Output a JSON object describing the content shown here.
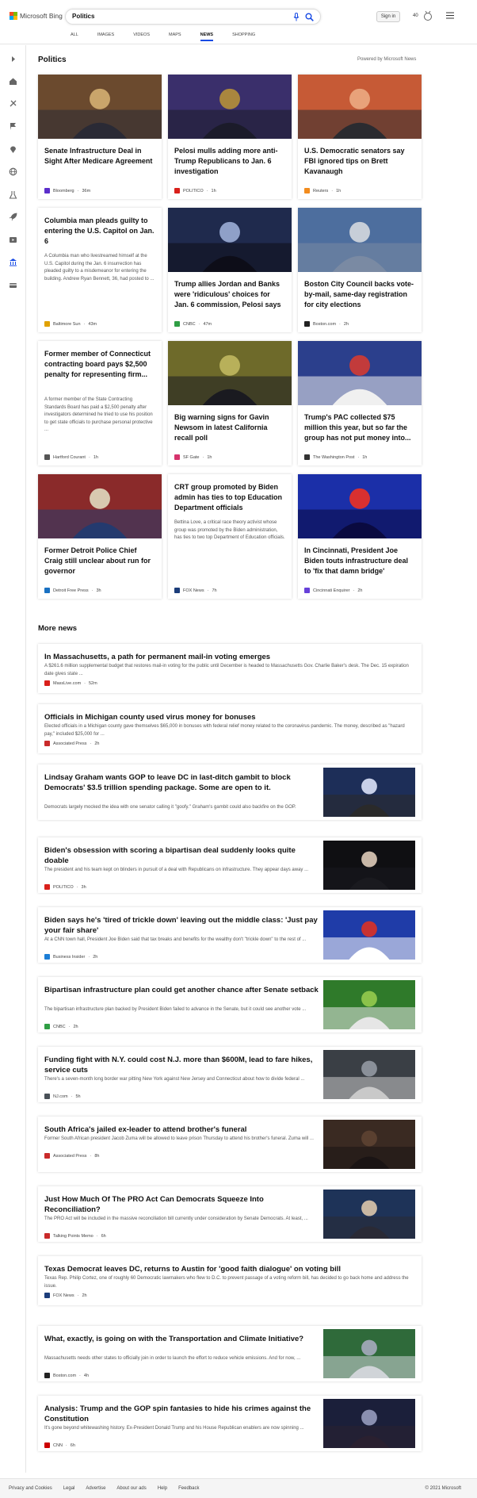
{
  "header": {
    "brand": "Microsoft Bing",
    "search_value": "Politics",
    "signin_label": "Sign in",
    "points": "40",
    "tabs": [
      "ALL",
      "IMAGES",
      "VIDEOS",
      "MAPS",
      "NEWS",
      "SHOPPING"
    ],
    "active_tab": "NEWS"
  },
  "rail": {
    "icons": [
      "expand-icon",
      "home-icon",
      "sports-icon",
      "flag-icon",
      "location-icon",
      "globe-icon",
      "science-icon",
      "rocket-icon",
      "entertainment-icon",
      "politics-icon",
      "money-icon"
    ]
  },
  "section": {
    "title": "Politics",
    "powered_by": "Powered by Microsoft News"
  },
  "cards": [
    {
      "title": "Senate Infrastructure Deal in Sight After Medicare Agreement",
      "snippet": "",
      "source": "Bloomberg",
      "time": "36m",
      "logo_color": "#5b2ecb",
      "image": "senate-photo"
    },
    {
      "title": "Pelosi mulls adding more anti-Trump Republicans to Jan. 6 investigation",
      "snippet": "",
      "source": "POLITICO",
      "time": "1h",
      "logo_color": "#d9201b",
      "image": "pelosi-photo"
    },
    {
      "title": "U.S. Democratic senators say FBI ignored tips on Brett Kavanaugh",
      "snippet": "",
      "source": "Reuters",
      "time": "1h",
      "logo_color": "#f28c1e",
      "image": "kavanaugh-photo"
    },
    {
      "title": "Columbia man pleads guilty to entering the U.S. Capitol on Jan. 6",
      "snippet": "A Columbia man who livestreamed himself at the U.S. Capitol during the Jan. 6 insurrection has pleaded guilty to a misdemeanor for entering the building. Andrew Ryan Bennett, 36, had posted to ...",
      "source": "Baltimore Sun",
      "time": "43m",
      "logo_color": "#e0a100",
      "image": ""
    },
    {
      "title": "Trump allies Jordan and Banks were 'ridiculous' choices for Jan. 6 commission, Pelosi says",
      "snippet": "",
      "source": "CNBC",
      "time": "47m",
      "logo_color": "#2f9e44",
      "image": "pelosi-speaking-photo"
    },
    {
      "title": "Boston City Council backs vote-by-mail, same-day registration for city elections",
      "snippet": "",
      "source": "Boston.com",
      "time": "2h",
      "logo_color": "#222222",
      "image": "vote-by-mail-photo"
    },
    {
      "title": "Former member of Connecticut contracting board pays $2,500 penalty for representing firm...",
      "snippet": "A former member of the State Contracting Standards Board has paid a $2,500 penalty after investigators determined he tried to use his position to get state officials to purchase personal protective ...",
      "source": "Hartford Courant",
      "time": "1h",
      "logo_color": "#555555",
      "image": ""
    },
    {
      "title": "Big warning signs for Gavin Newsom in latest California recall poll",
      "snippet": "",
      "source": "SF Gate",
      "time": "1h",
      "logo_color": "#d6336c",
      "image": "newsom-photo"
    },
    {
      "title": "Trump's PAC collected $75 million this year, but so far the group has not put money into...",
      "snippet": "",
      "source": "The Washington Post",
      "time": "1h",
      "logo_color": "#333333",
      "image": "trump-photo"
    },
    {
      "title": "Former Detroit Police Chief Craig still unclear about run for governor",
      "snippet": "",
      "source": "Detroit Free Press",
      "time": "3h",
      "logo_color": "#1971c2",
      "image": "craig-photo"
    },
    {
      "title": "CRT group promoted by Biden admin has ties to top Education Department officials",
      "snippet": "Bettina Love, a critical race theory activist whose group was promoted by the Biden administration, has ties to two top Department of Education officials.",
      "source": "FOX News",
      "time": "7h",
      "logo_color": "#1c3d7a",
      "image": ""
    },
    {
      "title": "In Cincinnati, President Joe Biden touts infrastructure deal to 'fix that damn bridge'",
      "snippet": "",
      "source": "Cincinnati Enquirer",
      "time": "2h",
      "logo_color": "#6741d9",
      "image": "cincinnati-photo"
    }
  ],
  "more_news": {
    "title": "More news",
    "items": [
      {
        "title": "In Massachusetts, a path for permanent mail-in voting emerges",
        "snippet": "A $261.6 million supplemental budget that restores mail-in voting for the public until December is headed to Massachusetts Gov. Charlie Baker's desk. The Dec. 15 expiration date gives state ...",
        "source": "MassLive.com",
        "time": "52m",
        "logo_color": "#d9201b",
        "image": ""
      },
      {
        "title": "Officials in Michigan county used virus money for bonuses",
        "snippet": "Elected officials in a Michigan county gave themselves $65,000 in bonuses with federal relief money related to the coronavirus pandemic. The money, described as \"hazard pay,\" included $25,000 for ...",
        "source": "Associated Press",
        "time": "2h",
        "logo_color": "#c92a2a",
        "image": ""
      },
      {
        "title": "Lindsay Graham wants GOP to leave DC in last-ditch gambit to block Democrats' $3.5 trillion spending package. Some are open to it.",
        "snippet": "Democrats largely mocked the idea with one senator calling it \"goofy.\" Graham's gambit could also backfire on the GOP.",
        "source": "Business Insider",
        "time": "1h",
        "logo_color": "#1c7ed6",
        "image": "senators-photo"
      },
      {
        "title": "Biden's obsession with scoring a bipartisan deal suddenly looks quite doable",
        "snippet": "The president and his team kept on blinders in pursuit of a deal with Republicans on infrastructure. They appear days away ...",
        "source": "POLITICO",
        "time": "3h",
        "logo_color": "#d9201b",
        "image": "biden-dark-photo"
      },
      {
        "title": "Biden says he's 'tired of trickle down' leaving out the middle class: 'Just pay your fair share'",
        "snippet": "At a CNN town hall, President Joe Biden said that tax breaks and benefits for the wealthy don't \"trickle down\" to the rest of ...",
        "source": "Business Insider",
        "time": "2h",
        "logo_color": "#1c7ed6",
        "image": "biden-townhall-photo"
      },
      {
        "title": "Bipartisan infrastructure plan could get another chance after Senate setback",
        "snippet": "The bipartisan infrastructure plan backed by President Biden failed to advance in the Senate, but it could see another vote ...",
        "source": "CNBC",
        "time": "2h",
        "logo_color": "#2f9e44",
        "image": "biden-tree-photo"
      },
      {
        "title": "Funding fight with N.Y. could cost N.J. more than $600M, lead to fare hikes, service cuts",
        "snippet": "There's a seven-month long border war pitting New York against New Jersey and Connecticut about how to divide federal ...",
        "source": "NJ.com",
        "time": "5h",
        "logo_color": "#495057",
        "image": "subway-photo"
      },
      {
        "title": "South Africa's jailed ex-leader to attend brother's funeral",
        "snippet": "Former South African president Jacob Zuma will be allowed to leave prison Thursday to attend his brother's funeral. Zuma will ...",
        "source": "Associated Press",
        "time": "8h",
        "logo_color": "#c92a2a",
        "image": "zuma-photo"
      },
      {
        "title": "Just How Much Of The PRO Act Can Democrats Squeeze Into Reconciliation?",
        "snippet": "The PRO Act will be included in the massive reconciliation bill currently under consideration by Senate Democrats. At least, ...",
        "source": "Talking Points Memo",
        "time": "6h",
        "logo_color": "#c92a2a",
        "image": "schumer-photo"
      },
      {
        "title": "Texas Democrat leaves DC, returns to Austin for 'good faith dialogue' on voting bill",
        "snippet": "Texas Rep. Philip Cortez, one of roughly 60 Democratic lawmakers who flew to D.C. to prevent passage of a voting reform bill, has decided to go back home and address the issue.",
        "source": "FOX News",
        "time": "2h",
        "logo_color": "#1c3d7a",
        "image": ""
      },
      {
        "title": "What, exactly, is going on with the Transportation and Climate Initiative?",
        "snippet": "Massachusetts needs other states to officially join in order to launch the effort to reduce vehicle emissions. And for now, ...",
        "source": "Boston.com",
        "time": "4h",
        "logo_color": "#222222",
        "image": "highway-photo"
      },
      {
        "title": "Analysis: Trump and the GOP spin fantasies to hide his crimes against the Constitution",
        "snippet": "It's gone beyond whitewashing history. Ex-President Donald Trump and his House Republican enablers are now spinning ...",
        "source": "CNN",
        "time": "6h",
        "logo_color": "#cc0000",
        "image": "trump-podium-photo"
      }
    ]
  },
  "footer": {
    "links": [
      "Privacy and Cookies",
      "Legal",
      "Advertise",
      "About our ads",
      "Help",
      "Feedback"
    ],
    "copyright": "© 2021 Microsoft"
  }
}
